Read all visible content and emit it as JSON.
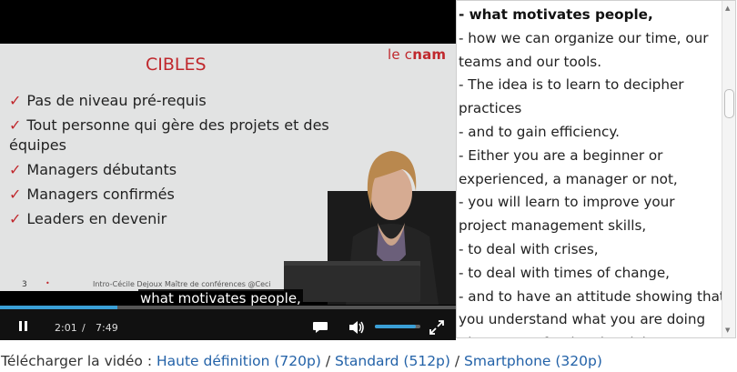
{
  "player": {
    "slide": {
      "title": "CIBLES",
      "logo_left": "le c",
      "logo_right": "nam",
      "bullets": [
        "Pas de niveau pré-requis",
        "Tout personne qui gère des projets et des équipes",
        "Managers débutants",
        "Managers confirmés",
        "Leaders en devenir"
      ],
      "page_number": "3",
      "footer": "Intro-Cécile Dejoux Maître de conférences @Ceci"
    },
    "subtitle": "what motivates people,",
    "current_time": "2:01",
    "separator": "/",
    "duration": "7:49",
    "progress_fraction": 0.258,
    "volume_fraction": 0.9,
    "accent_color": "#3a9fd6"
  },
  "transcript": {
    "lines": [
      "- what motivates people,",
      " - how we can organize our time, our",
      "teams and our tools.",
      " - The idea is to learn to decipher",
      "practices",
      " - and to gain efficiency.",
      " - Either you are a beginner or",
      "experienced, a manager or not,",
      " - you will learn to improve your",
      "project management skills,",
      " - to deal with crises,",
      " - to deal with times of change,",
      " - and to have an attitude showing that",
      "you understand what you are doing",
      " - in your professional activity."
    ],
    "active_index": 0
  },
  "download": {
    "prefix": "Télécharger la vidéo : ",
    "links": [
      "Haute définition (720p)",
      "Standard (512p)",
      "Smartphone (320p)"
    ],
    "separator": " / ",
    "link_color": "#2362a8"
  }
}
